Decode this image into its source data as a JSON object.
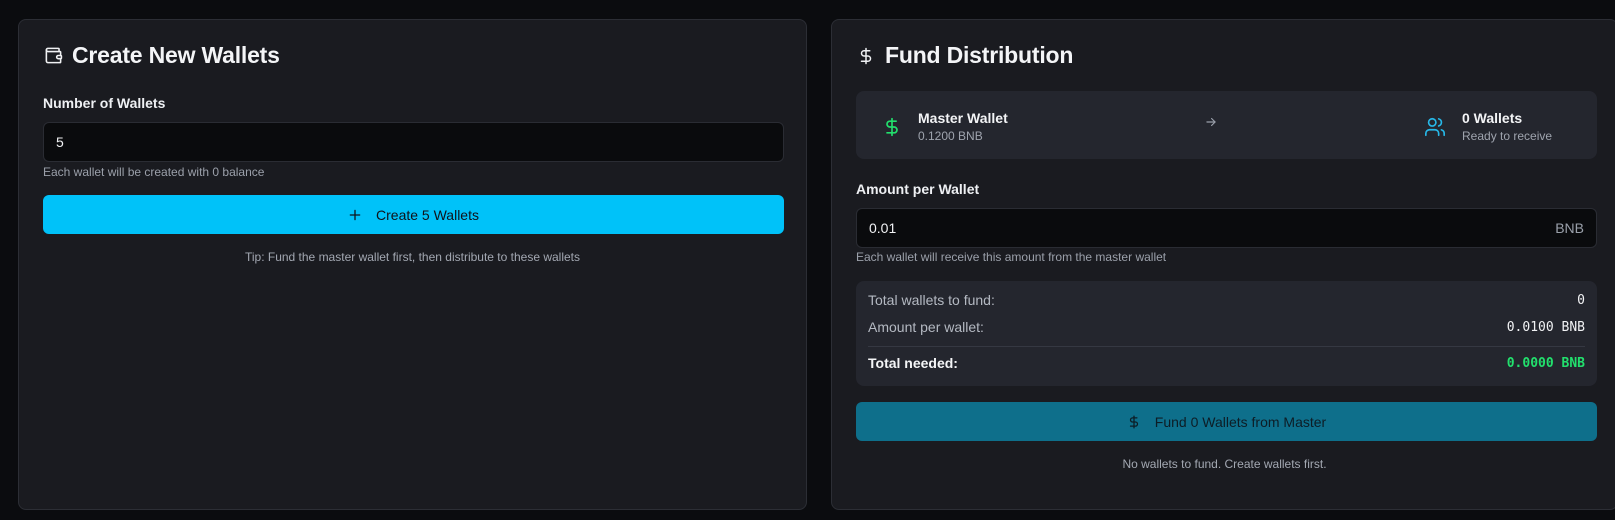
{
  "create": {
    "title": "Create New Wallets",
    "icon": "wallet-icon",
    "number_label": "Number of Wallets",
    "number_value": "5",
    "number_hint": "Each wallet will be created with 0 balance",
    "button_label": "Create 5 Wallets",
    "button_icon": "plus-icon",
    "tip": "Tip: Fund the master wallet first, then distribute to these wallets",
    "accent": "#00c2f9"
  },
  "fund": {
    "title": "Fund Distribution",
    "icon": "dollar-icon",
    "master": {
      "title": "Master Wallet",
      "balance": "0.1200 BNB",
      "icon": "dollar-icon",
      "icon_color": "#22e06d"
    },
    "arrow_icon": "arrow-right-icon",
    "wallets": {
      "title": "0 Wallets",
      "subtitle": "Ready to receive",
      "icon": "users-icon",
      "icon_color": "#27b8e8"
    },
    "amount_label": "Amount per Wallet",
    "amount_value": "0.01",
    "amount_suffix": "BNB",
    "amount_hint": "Each wallet will receive this amount from the master wallet",
    "summary": {
      "total_wallets_label": "Total wallets to fund:",
      "total_wallets_value": "0",
      "amount_per_wallet_label": "Amount per wallet:",
      "amount_per_wallet_value": "0.0100 BNB",
      "total_needed_label": "Total needed:",
      "total_needed_value": "0.0000 BNB"
    },
    "button_label": "Fund 0 Wallets from Master",
    "button_icon": "dollar-icon",
    "note": "No wallets to fund. Create wallets first.",
    "button_color": "#0e6f8b"
  }
}
